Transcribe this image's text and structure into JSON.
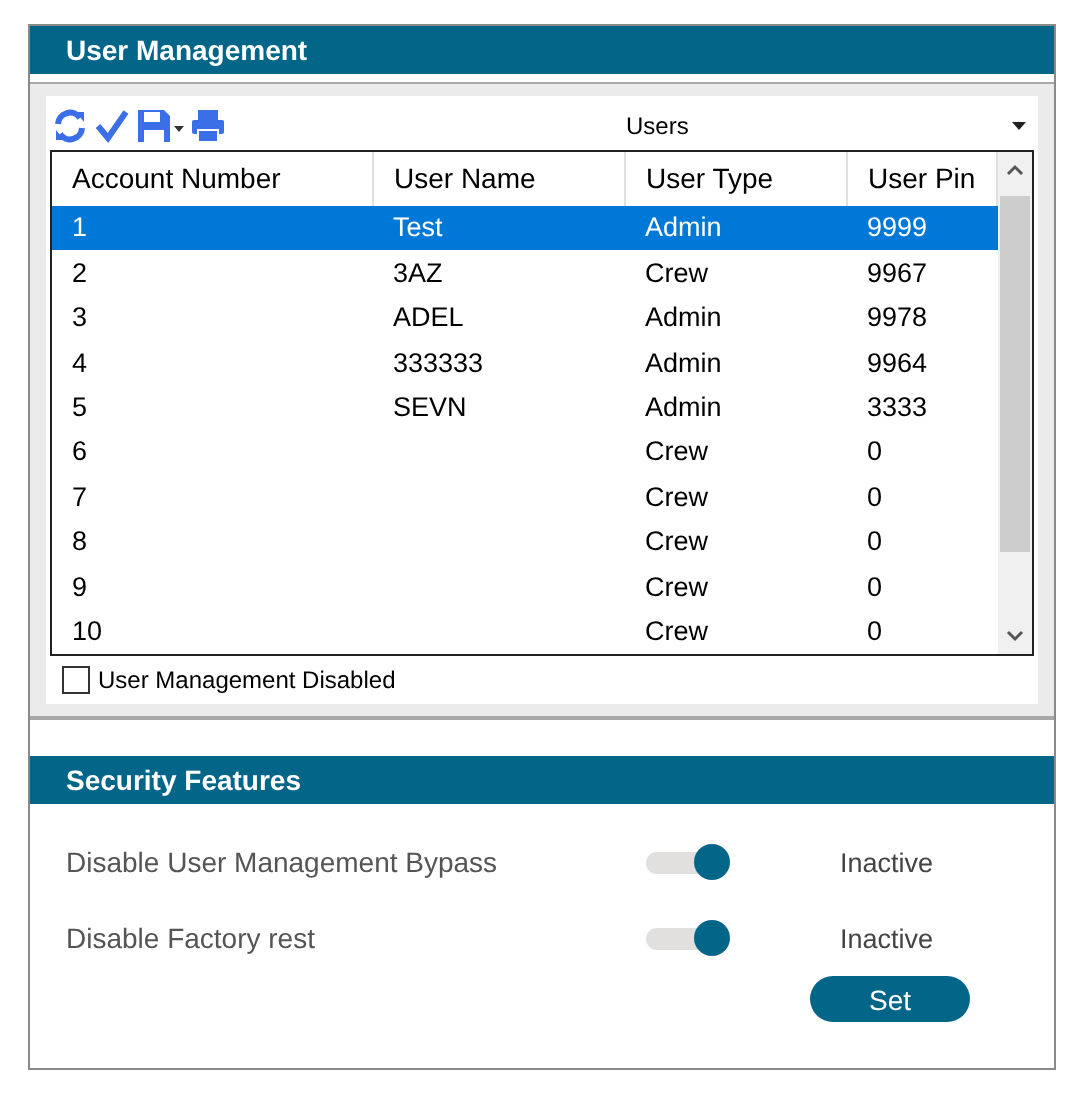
{
  "user_management": {
    "title": "User Management",
    "toolbar": {
      "dropdown_value": "Users"
    },
    "table": {
      "columns": [
        "Account Number",
        "User Name",
        "User Type",
        "User Pin"
      ],
      "rows": [
        {
          "account_number": "1",
          "user_name": "Test",
          "user_type": "Admin",
          "user_pin": "9999",
          "selected": true
        },
        {
          "account_number": "2",
          "user_name": "3AZ",
          "user_type": "Crew",
          "user_pin": "9967",
          "selected": false
        },
        {
          "account_number": "3",
          "user_name": "ADEL",
          "user_type": "Admin",
          "user_pin": "9978",
          "selected": false
        },
        {
          "account_number": "4",
          "user_name": "333333",
          "user_type": "Admin",
          "user_pin": "9964",
          "selected": false
        },
        {
          "account_number": "5",
          "user_name": "SEVN",
          "user_type": "Admin",
          "user_pin": "3333",
          "selected": false
        },
        {
          "account_number": "6",
          "user_type": "Crew",
          "user_pin": "0",
          "selected": false
        },
        {
          "account_number": "7",
          "user_type": "Crew",
          "user_pin": "0",
          "selected": false
        },
        {
          "account_number": "8",
          "user_type": "Crew",
          "user_pin": "0",
          "selected": false
        },
        {
          "account_number": "9",
          "user_type": "Crew",
          "user_pin": "0",
          "selected": false
        },
        {
          "account_number": "10",
          "user_type": "Crew",
          "user_pin": "0",
          "selected": false
        }
      ]
    },
    "disabled_checkbox": {
      "label": "User Management Disabled",
      "checked": false
    }
  },
  "security_features": {
    "title": "Security Features",
    "settings": [
      {
        "label": "Disable User Management Bypass",
        "on": true,
        "status": "Inactive"
      },
      {
        "label": "Disable Factory rest",
        "on": true,
        "status": "Inactive"
      }
    ],
    "set_button": "Set"
  }
}
